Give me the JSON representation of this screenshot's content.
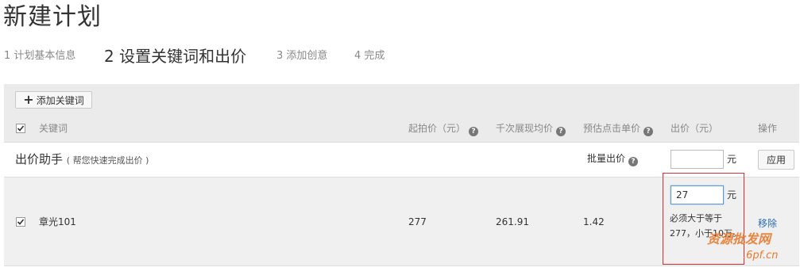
{
  "page": {
    "title": "新建计划"
  },
  "steps": [
    {
      "label": "1 计划基本信息"
    },
    {
      "label": "2 设置关键词和出价"
    },
    {
      "label": "3 添加创意"
    },
    {
      "label": "4 完成"
    }
  ],
  "toolbar": {
    "add_keyword_label": "添加关键词"
  },
  "table": {
    "headers": {
      "keyword": "关键词",
      "start_price": "起拍价（元）",
      "cpm": "千次展现均价",
      "est_cpc": "预估点击单价",
      "bid": "出价（元）",
      "action": "操作"
    },
    "helper": {
      "title": "出价助手",
      "subtitle": "( 帮您快速完成出价 )",
      "batch_label": "批量出价",
      "batch_value": "",
      "unit": "元",
      "apply_label": "应用"
    },
    "rows": [
      {
        "keyword": "章光101",
        "start_price": "277",
        "cpm": "261.91",
        "est_cpc": "1.42",
        "bid": "27",
        "unit": "元",
        "error": "必须大于等于277，小于10万。",
        "remove": "移除"
      }
    ]
  },
  "watermark": {
    "line1": "资源批发网",
    "line2": ".6pf.cn"
  },
  "colors": {
    "error_border": "#d03030",
    "link": "#2b6cb0",
    "header_bg": "#ebebeb",
    "row_bg": "#f0f0f0"
  }
}
